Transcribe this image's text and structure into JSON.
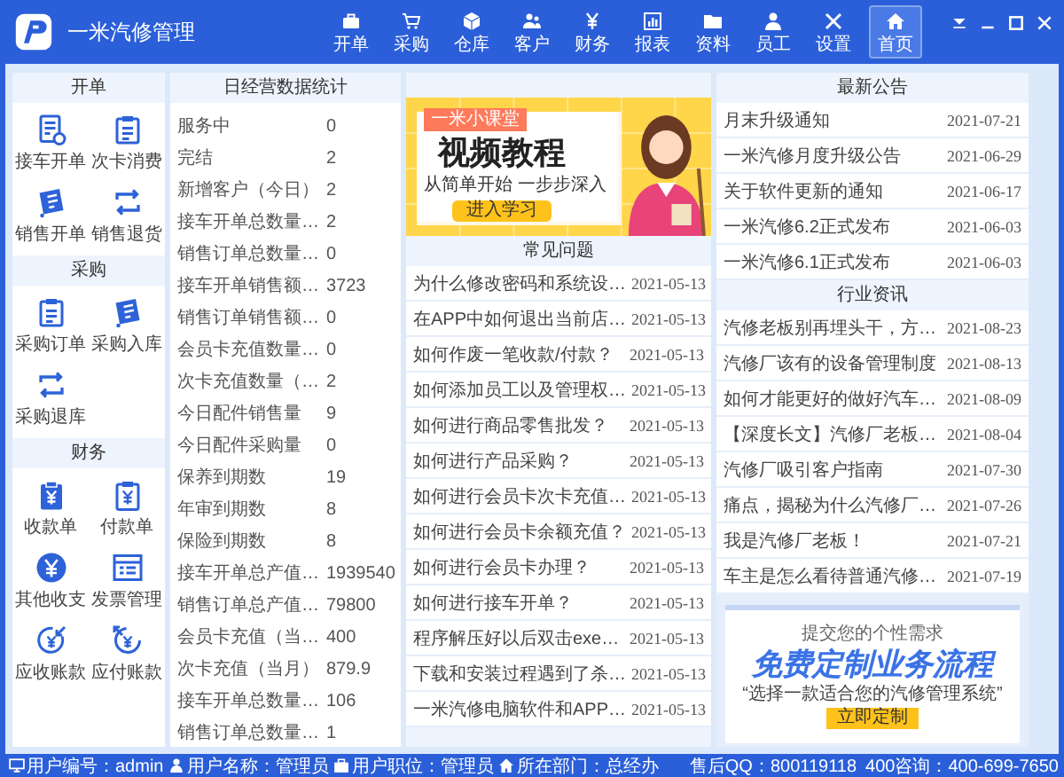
{
  "window": {
    "title": "一米汽修管理"
  },
  "nav": [
    {
      "label": "开单",
      "selected": false
    },
    {
      "label": "采购",
      "selected": false
    },
    {
      "label": "仓库",
      "selected": false
    },
    {
      "label": "客户",
      "selected": false
    },
    {
      "label": "财务",
      "selected": false
    },
    {
      "label": "报表",
      "selected": false
    },
    {
      "label": "资料",
      "selected": false
    },
    {
      "label": "员工",
      "selected": false
    },
    {
      "label": "设置",
      "selected": false
    },
    {
      "label": "首页",
      "selected": true
    }
  ],
  "shortcuts": [
    {
      "title": "开单",
      "items": [
        "接车开单",
        "次卡消费",
        "销售开单",
        "销售退货"
      ]
    },
    {
      "title": "采购",
      "items": [
        "采购订单",
        "采购入库",
        "采购退库"
      ]
    },
    {
      "title": "财务",
      "items": [
        "收款单",
        "付款单",
        "其他收支",
        "发票管理",
        "应收账款",
        "应付账款"
      ]
    }
  ],
  "stats": {
    "title": "日经营数据统计",
    "rows": [
      {
        "label": "服务中",
        "value": "0"
      },
      {
        "label": "完结",
        "value": "2"
      },
      {
        "label": "新增客户（今日）",
        "value": "2"
      },
      {
        "label": "接车开单总数量…",
        "value": "2"
      },
      {
        "label": "销售订单总数量…",
        "value": "0"
      },
      {
        "label": "接车开单销售额…",
        "value": "3723"
      },
      {
        "label": "销售订单销售额…",
        "value": "0"
      },
      {
        "label": "会员卡充值数量…",
        "value": "0"
      },
      {
        "label": "次卡充值数量（…",
        "value": "2"
      },
      {
        "label": "今日配件销售量",
        "value": "9"
      },
      {
        "label": "今日配件采购量",
        "value": "0"
      },
      {
        "label": "保养到期数",
        "value": "19"
      },
      {
        "label": "年审到期数",
        "value": "8"
      },
      {
        "label": "保险到期数",
        "value": "8"
      },
      {
        "label": "接车开单总产值…",
        "value": "1939540"
      },
      {
        "label": "销售订单总产值…",
        "value": "79800"
      },
      {
        "label": "会员卡充值（当…",
        "value": "400"
      },
      {
        "label": "次卡充值（当月）",
        "value": "879.9"
      },
      {
        "label": "接车开单总数量…",
        "value": "106"
      },
      {
        "label": "销售订单总数量…",
        "value": "1"
      }
    ]
  },
  "promo": {
    "tag": "一米小课堂",
    "title": "视频教程",
    "subtitle": "从简单开始 一步步深入",
    "button": "进入学习"
  },
  "faq": {
    "title": "常见问题",
    "rows": [
      {
        "title": "为什么修改密码和系统设…",
        "date": "2021-05-13"
      },
      {
        "title": "在APP中如何退出当前店…",
        "date": "2021-05-13"
      },
      {
        "title": "如何作废一笔收款/付款？",
        "date": "2021-05-13"
      },
      {
        "title": "如何添加员工以及管理权…",
        "date": "2021-05-13"
      },
      {
        "title": "如何进行商品零售批发？",
        "date": "2021-05-13"
      },
      {
        "title": "如何进行产品采购？",
        "date": "2021-05-13"
      },
      {
        "title": "如何进行会员卡次卡充值…",
        "date": "2021-05-13"
      },
      {
        "title": "如何进行会员卡余额充值？",
        "date": "2021-05-13"
      },
      {
        "title": "如何进行会员卡办理？",
        "date": "2021-05-13"
      },
      {
        "title": "如何进行接车开单？",
        "date": "2021-05-13"
      },
      {
        "title": "程序解压好以后双击exe…",
        "date": "2021-05-13"
      },
      {
        "title": "下载和安装过程遇到了杀…",
        "date": "2021-05-13"
      },
      {
        "title": "一米汽修电脑软件和APP…",
        "date": "2021-05-13"
      }
    ]
  },
  "announcements": {
    "title": "最新公告",
    "rows": [
      {
        "title": "月末升级通知",
        "date": "2021-07-21"
      },
      {
        "title": "一米汽修月度升级公告",
        "date": "2021-06-29"
      },
      {
        "title": "关于软件更新的通知",
        "date": "2021-06-17"
      },
      {
        "title": "一米汽修6.2正式发布",
        "date": "2021-06-03"
      },
      {
        "title": "一米汽修6.1正式发布",
        "date": "2021-06-03"
      }
    ]
  },
  "news": {
    "title": "行业资讯",
    "rows": [
      {
        "title": "汽修老板别再埋头干，方…",
        "date": "2021-08-23"
      },
      {
        "title": "汽修厂该有的设备管理制度",
        "date": "2021-08-13"
      },
      {
        "title": "如何才能更好的做好汽车…",
        "date": "2021-08-09"
      },
      {
        "title": "【深度长文】汽修厂老板…",
        "date": "2021-08-04"
      },
      {
        "title": "汽修厂吸引客户指南",
        "date": "2021-07-30"
      },
      {
        "title": "痛点，揭秘为什么汽修厂…",
        "date": "2021-07-26"
      },
      {
        "title": "我是汽修厂老板！",
        "date": "2021-07-21"
      },
      {
        "title": "车主是怎么看待普通汽修…",
        "date": "2021-07-19"
      }
    ]
  },
  "ad": {
    "caption": "提交您的个性需求",
    "title": "免费定制业务流程",
    "subtitle": "“选择一款适合您的汽修管理系统”",
    "button": "立即定制"
  },
  "status_bar": {
    "left": [
      "用户编号：admin",
      "用户名称：管理员",
      "用户职位：管理员",
      "所在部门：总经办"
    ],
    "right": [
      "售后QQ：800119118",
      "400咨询：400-699-7650"
    ]
  }
}
